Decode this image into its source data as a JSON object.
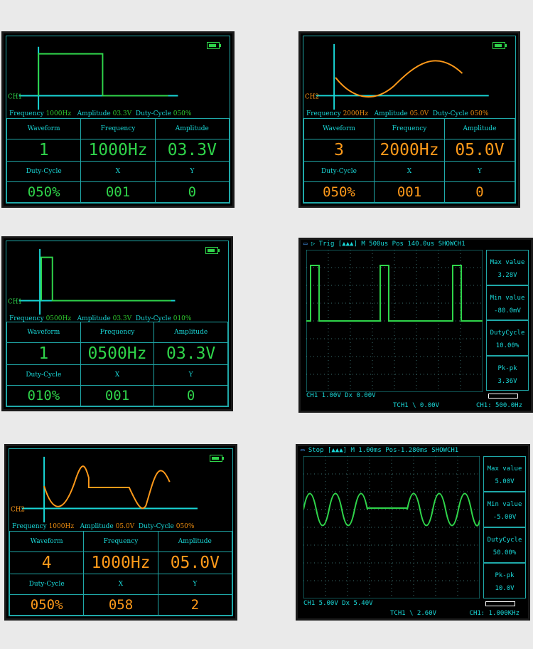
{
  "panels": [
    {
      "channel": "CH1",
      "frequency": "1000Hz",
      "amplitude": "03.3V",
      "duty": "050%",
      "labels": {
        "frequency": "Frequency",
        "amplitude": "Amplitude",
        "duty": "Duty-Cycle"
      },
      "headers": [
        "Waveform",
        "Frequency",
        "Amplitude"
      ],
      "values": [
        "1",
        "1000Hz",
        "03.3V"
      ],
      "headers2": [
        "Duty-Cycle",
        "X",
        "Y"
      ],
      "values2": [
        "050%",
        "001",
        "0"
      ]
    },
    {
      "channel": "CH2",
      "frequency": "2000Hz",
      "amplitude": "05.0V",
      "duty": "050%",
      "labels": {
        "frequency": "Frequency",
        "amplitude": "Amplitude",
        "duty": "Duty-Cycle"
      },
      "headers": [
        "Waveform",
        "Frequency",
        "Amplitude"
      ],
      "values": [
        "3",
        "2000Hz",
        "05.0V"
      ],
      "headers2": [
        "Duty-Cycle",
        "X",
        "Y"
      ],
      "values2": [
        "050%",
        "001",
        "0"
      ]
    },
    {
      "channel": "CH1",
      "frequency": "0500Hz",
      "amplitude": "03.3V",
      "duty": "010%",
      "labels": {
        "frequency": "Frequency",
        "amplitude": "Amplitude",
        "duty": "Duty-Cycle"
      },
      "headers": [
        "Waveform",
        "Frequency",
        "Amplitude"
      ],
      "values": [
        "1",
        "0500Hz",
        "03.3V"
      ],
      "headers2": [
        "Duty-Cycle",
        "X",
        "Y"
      ],
      "values2": [
        "010%",
        "001",
        "0"
      ]
    },
    {
      "channel": "CH2",
      "frequency": "1000Hz",
      "amplitude": "05.0V",
      "duty": "050%",
      "labels": {
        "frequency": "Frequency",
        "amplitude": "Amplitude",
        "duty": "Duty-Cycle"
      },
      "headers": [
        "Waveform",
        "Frequency",
        "Amplitude"
      ],
      "values": [
        "4",
        "1000Hz",
        "05.0V"
      ],
      "headers2": [
        "Duty-Cycle",
        "X",
        "Y"
      ],
      "values2": [
        "050%",
        "058",
        "2"
      ]
    }
  ],
  "scopes": [
    {
      "mode": "Trig",
      "timebase": "M 500us",
      "pos": "Pos 140.0us",
      "sw": "SHOWCH1",
      "side": [
        {
          "l": "Max value",
          "v": "3.28V"
        },
        {
          "l": "Min value",
          "v": "-80.0mV"
        },
        {
          "l": "DutyCycle",
          "v": "10.00%"
        },
        {
          "l": "Pk-pk",
          "v": "3.36V"
        }
      ],
      "bottom1": "CH1 1.00V  Dx 0.00V",
      "bottom2": "TCH1 \\ 0.00V",
      "bottom3": "CH1: 500.0Hz"
    },
    {
      "mode": "Stop",
      "timebase": "M 1.00ms",
      "pos": "Pos-1.280ms",
      "sw": "SHOWCH1",
      "side": [
        {
          "l": "Max value",
          "v": "5.00V"
        },
        {
          "l": "Min value",
          "v": "-5.00V"
        },
        {
          "l": "DutyCycle",
          "v": "50.00%"
        },
        {
          "l": "Pk-pk",
          "v": "10.0V"
        }
      ],
      "bottom1": "CH1 5.00V  Dx 5.40V",
      "bottom2": "TCH1 \\ 2.60V",
      "bottom3": "CH1: 1.000KHz"
    }
  ],
  "colors": {
    "cyan": "#19d7d7",
    "green": "#2fd44a",
    "orange": "#ff9a1a"
  }
}
